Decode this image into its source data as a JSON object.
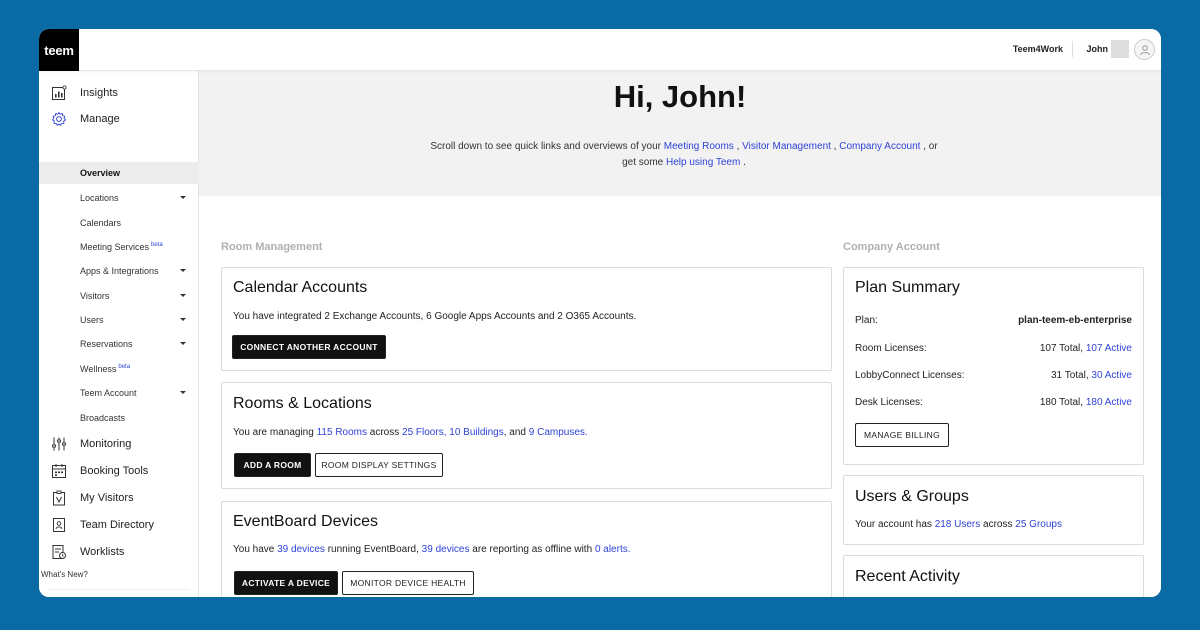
{
  "topbar": {
    "logo": "teem",
    "org": "Teem4Work",
    "user": "John F"
  },
  "sidebar": {
    "main_top": [
      {
        "label": "Insights",
        "icon": "insights-icon"
      },
      {
        "label": "Manage",
        "icon": "gear-icon"
      }
    ],
    "manage_items": [
      {
        "label": "Overview",
        "active": true,
        "caret": false
      },
      {
        "label": "Locations",
        "caret": true
      },
      {
        "label": "Calendars",
        "caret": false
      },
      {
        "label": "Meeting Services",
        "beta": "beta",
        "caret": false
      },
      {
        "label": "Apps & Integrations",
        "caret": true
      },
      {
        "label": "Visitors",
        "caret": true
      },
      {
        "label": "Users",
        "caret": true
      },
      {
        "label": "Reservations",
        "caret": true
      },
      {
        "label": "Wellness",
        "beta": "beta",
        "caret": false
      },
      {
        "label": "Teem Account",
        "caret": true
      },
      {
        "label": "Broadcasts",
        "caret": false
      }
    ],
    "main_bottom": [
      {
        "label": "Monitoring",
        "icon": "sliders-icon"
      },
      {
        "label": "Booking Tools",
        "icon": "calendar-icon"
      },
      {
        "label": "My Visitors",
        "icon": "visitor-badge-icon"
      },
      {
        "label": "Team Directory",
        "icon": "directory-icon"
      },
      {
        "label": "Worklists",
        "icon": "worklist-icon"
      }
    ],
    "whats_new": "What's New?"
  },
  "hero": {
    "greeting": "Hi, John!",
    "intro_1": "Scroll down to see quick links and overviews of your ",
    "link_meeting_rooms": "Meeting Rooms",
    "sep_1": " , ",
    "link_visitor_mgmt": "Visitor Management",
    "sep_2": " , ",
    "link_company_account": "Company Account",
    "intro_2": " , or get some ",
    "link_help": "Help using Teem",
    "intro_3": " ."
  },
  "room_management": {
    "section_title": "Room Management",
    "calendar": {
      "title": "Calendar Accounts",
      "text": "You have integrated 2 Exchange Accounts, 6 Google Apps Accounts and 2 O365 Accounts.",
      "button": "CONNECT ANOTHER ACCOUNT"
    },
    "rooms": {
      "title": "Rooms & Locations",
      "t1": "You are managing ",
      "rooms_link": "115 Rooms",
      "t2": " across ",
      "floors_link": "25 Floors",
      "t3": ", ",
      "buildings_link": "10 Buildings",
      "t4": ", and ",
      "campuses_link": "9 Campuses",
      "t5": ".",
      "add_button": "ADD A ROOM",
      "display_button": "ROOM DISPLAY SETTINGS"
    },
    "devices": {
      "title": "EventBoard Devices",
      "t1": "You have ",
      "devices_link": "39 devices",
      "t2": " running EventBoard, ",
      "offline_link": "39 devices",
      "t3": " are reporting as offline with ",
      "alerts_link": "0 alerts",
      "t4": ".",
      "activate_button": "ACTIVATE A DEVICE",
      "monitor_button": "MONITOR DEVICE HEALTH"
    }
  },
  "company_account": {
    "section_title": "Company Account",
    "plan": {
      "title": "Plan Summary",
      "rows": [
        {
          "label": "Plan:",
          "value": "plan-teem-eb-enterprise"
        },
        {
          "label": "Room Licenses:",
          "total": "107 Total, ",
          "active": "107 Active"
        },
        {
          "label": "LobbyConnect Licenses:",
          "total": "31 Total, ",
          "active": "30 Active"
        },
        {
          "label": "Desk Licenses:",
          "total": "180 Total, ",
          "active": "180 Active"
        }
      ],
      "button": "MANAGE BILLING"
    },
    "users": {
      "title": "Users & Groups",
      "t1": "Your account has ",
      "users_link": "218 Users",
      "t2": " across ",
      "groups_link": "25 Groups"
    },
    "activity": {
      "title": "Recent Activity"
    }
  }
}
